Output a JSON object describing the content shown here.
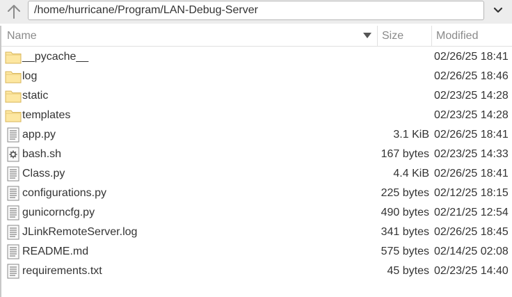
{
  "toolbar": {
    "path": "/home/hurricane/Program/LAN-Debug-Server"
  },
  "columns": {
    "name": "Name",
    "size": "Size",
    "modified": "Modified"
  },
  "files": [
    {
      "name": "__pycache__",
      "size": "",
      "modified": "02/26/25 18:41",
      "icon": "folder-icon"
    },
    {
      "name": "log",
      "size": "",
      "modified": "02/26/25 18:46",
      "icon": "folder-icon"
    },
    {
      "name": "static",
      "size": "",
      "modified": "02/23/25 14:28",
      "icon": "folder-icon"
    },
    {
      "name": "templates",
      "size": "",
      "modified": "02/23/25 14:28",
      "icon": "folder-icon"
    },
    {
      "name": "app.py",
      "size": "3.1 KiB",
      "modified": "02/26/25 18:41",
      "icon": "text-file-icon"
    },
    {
      "name": "bash.sh",
      "size": "167 bytes",
      "modified": "02/23/25 14:33",
      "icon": "script-file-icon"
    },
    {
      "name": "Class.py",
      "size": "4.4 KiB",
      "modified": "02/26/25 18:41",
      "icon": "text-file-icon"
    },
    {
      "name": "configurations.py",
      "size": "225 bytes",
      "modified": "02/12/25 18:15",
      "icon": "text-file-icon"
    },
    {
      "name": "gunicorncfg.py",
      "size": "490 bytes",
      "modified": "02/21/25 12:54",
      "icon": "text-file-icon"
    },
    {
      "name": "JLinkRemoteServer.log",
      "size": "341 bytes",
      "modified": "02/26/25 18:45",
      "icon": "text-file-icon"
    },
    {
      "name": "README.md",
      "size": "575 bytes",
      "modified": "02/14/25 02:08",
      "icon": "text-file-icon"
    },
    {
      "name": "requirements.txt",
      "size": "45 bytes",
      "modified": "02/23/25 14:40",
      "icon": "text-file-icon"
    }
  ]
}
